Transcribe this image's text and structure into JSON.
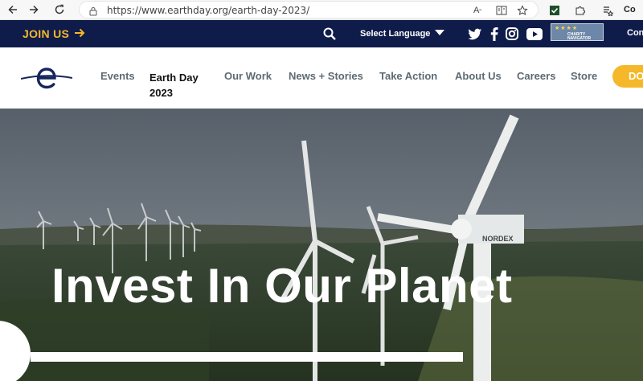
{
  "browser": {
    "url": "https://www.earthday.org/earth-day-2023/",
    "profile_text": "Co"
  },
  "topbar": {
    "join_label": "JOIN US",
    "language_label": "Select Language",
    "charity_badge_text": "CHARITY NAVIGATOR",
    "cut_text": "Con"
  },
  "nav": {
    "items": [
      "Events",
      "Earth Day 2023",
      "Our Work",
      "News + Stories",
      "Take Action",
      "About Us",
      "Careers",
      "Store"
    ],
    "active_line1": "Earth Day",
    "active_line2": "2023",
    "donate_label": "DO"
  },
  "hero": {
    "headline": "Invest In Our Planet"
  },
  "colors": {
    "navy": "#0f1c4a",
    "accent": "#f5b82a"
  },
  "icons": [
    "back-arrow-icon",
    "forward-arrow-icon",
    "refresh-icon",
    "lock-icon",
    "read-aloud-icon",
    "reader-view-icon",
    "favorite-icon",
    "extension-check-icon",
    "puzzle-icon",
    "collections-icon",
    "search-icon",
    "twitter-icon",
    "facebook-icon",
    "instagram-icon",
    "youtube-icon"
  ]
}
